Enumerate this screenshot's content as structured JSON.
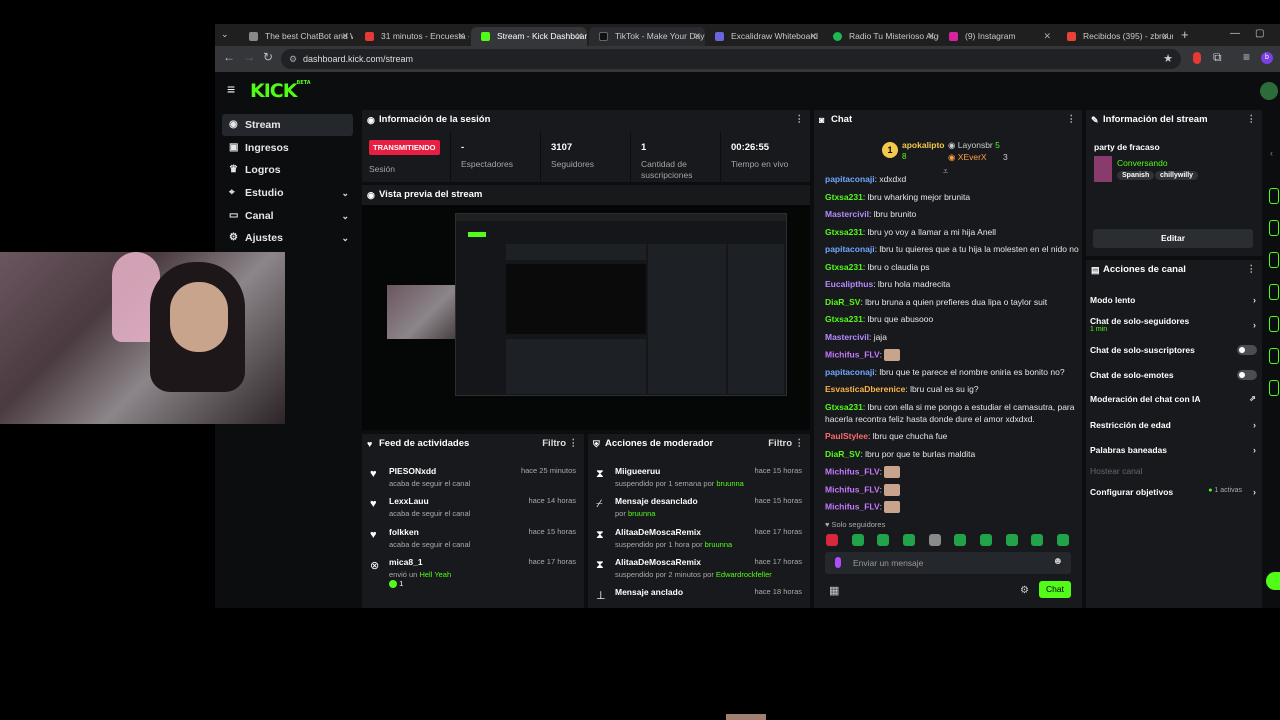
{
  "browser": {
    "tabs": [
      {
        "label": "The best ChatBot and W",
        "color": "#888888"
      },
      {
        "label": "31 minutos - Encuesta - ...",
        "color": "#e53935"
      },
      {
        "label": "Stream - Kick Dashboard",
        "color": "#53fc18"
      },
      {
        "label": "TikTok - Make Your Day",
        "color": "#111111"
      },
      {
        "label": "Excalidraw Whiteboard",
        "color": "#6965db"
      },
      {
        "label": "Radio Tu Misterioso Algu",
        "color": "#1db954"
      },
      {
        "label": "(9) Instagram",
        "color": "#d6249f"
      },
      {
        "label": "Recibidos (395) - zbruun",
        "color": "#ea4335"
      }
    ],
    "url": "dashboard.kick.com/stream",
    "new_tab": "+"
  },
  "brand": {
    "logo": "KICK",
    "beta": "BETA",
    "accent": "#53fc18"
  },
  "sidebar": [
    {
      "label": "Stream",
      "icon": "broadcast-icon"
    },
    {
      "label": "Ingresos",
      "icon": "wallet-icon"
    },
    {
      "label": "Logros",
      "icon": "trophy-icon"
    },
    {
      "label": "Estudio",
      "icon": "studio-icon"
    },
    {
      "label": "Canal",
      "icon": "channel-icon"
    },
    {
      "label": "Ajustes",
      "icon": "gear-icon"
    }
  ],
  "session": {
    "title": "Información de la sesión",
    "status_badge": "TRANSMITIENDO",
    "status_label": "Sesión",
    "stats": [
      {
        "value": "-",
        "label": "Espectadores"
      },
      {
        "value": "3107",
        "label": "Seguidores"
      },
      {
        "value": "1",
        "label": "Cantidad de suscripciones"
      },
      {
        "value": "00:26:55",
        "label": "Tiempo en vivo"
      }
    ]
  },
  "preview": {
    "title": "Vista previa del stream"
  },
  "feed": {
    "title": "Feed de actividades",
    "filter": "Filtro",
    "items": [
      {
        "name": "PIESONxdd",
        "desc": "acaba de seguir el canal",
        "time": "hace 25 minutos"
      },
      {
        "name": "LexxLauu",
        "desc": "acaba de seguir el canal",
        "time": "hace 14 horas"
      },
      {
        "name": "folkken",
        "desc": "acaba de seguir el canal",
        "time": "hace 15 horas"
      },
      {
        "name": "mica8_1",
        "desc": "envió un ",
        "highlight": "Hell Yeah",
        "count": "1",
        "time": "hace 17 horas"
      }
    ]
  },
  "mod": {
    "title": "Acciones de moderador",
    "filter": "Filtro",
    "items": [
      {
        "name": "Miigueeruu",
        "desc": "suspendido por 1 semana por ",
        "by": "bruunna",
        "time": "hace 15 horas"
      },
      {
        "name": "Mensaje desanclado",
        "desc": "por ",
        "by": "bruunna",
        "time": "hace 15 horas"
      },
      {
        "name": "AlitaaDeMoscaRemix",
        "desc": "suspendido por 1 hora por ",
        "by": "bruunna",
        "time": "hace 17 horas"
      },
      {
        "name": "AlitaaDeMoscaRemix",
        "desc": "suspendido por 2 minutos por ",
        "by": "Edwardrockfeller",
        "time": "hace 17 horas"
      },
      {
        "name": "Mensaje anclado",
        "desc": "",
        "by": "",
        "time": "hace 18 horas"
      }
    ]
  },
  "chat": {
    "title": "Chat",
    "top_gifters": [
      {
        "rank": "1",
        "name": "apokalipto",
        "count": "8"
      },
      {
        "name": "Layonsbr",
        "count": "5"
      },
      {
        "name": "XEverX",
        "count": "3"
      }
    ],
    "messages": [
      {
        "user": "papitaconaji",
        "color": "#6ea8ff",
        "text": "xdxdxd"
      },
      {
        "user": "Gtxsa231",
        "color": "#53fc18",
        "text": "lbru wharking mejor brunita"
      },
      {
        "user": "Mastercivil",
        "color": "#b48cff",
        "text": "lbru brunito"
      },
      {
        "user": "Gtxsa231",
        "color": "#53fc18",
        "text": "lbru yo voy a llamar a mi hija Anell"
      },
      {
        "user": "papitaconaji",
        "color": "#6ea8ff",
        "text": "lbru tu quieres que a tu hija la molesten en el nido no"
      },
      {
        "user": "Gtxsa231",
        "color": "#53fc18",
        "text": "lbru o claudia ps"
      },
      {
        "user": "Eucalipthus",
        "color": "#b48cff",
        "text": "lbru hola madrecita"
      },
      {
        "user": "DiaR_SV",
        "color": "#53fc18",
        "text": "lbru bruna a quien prefieres dua lipa o taylor suit"
      },
      {
        "user": "Gtxsa231",
        "color": "#53fc18",
        "text": "lbru que abusooo"
      },
      {
        "user": "Mastercivil",
        "color": "#b48cff",
        "text": "jaja"
      },
      {
        "user": "Michifus_FLV",
        "color": "#c678ff",
        "text": ""
      },
      {
        "user": "papitaconaji",
        "color": "#6ea8ff",
        "text": "lbru que te parece el nombre oniria es bonito no?"
      },
      {
        "user": "EsvasticaDberenice",
        "color": "#ffb347",
        "text": "lbru cual es su ig?"
      },
      {
        "user": "Gtxsa231",
        "color": "#53fc18",
        "text": "lbru con ella si me pongo a estudiar el camasutra, para"
      },
      {
        "user": "",
        "color": "#e6e6e6",
        "text": "hacerla recontra feliz hasta donde dure el amor xdxdxd."
      },
      {
        "user": "PaulStylee",
        "color": "#ff6b6b",
        "text": "lbru que chucha fue"
      },
      {
        "user": "DiaR_SV",
        "color": "#53fc18",
        "text": "lbru por que te burlas maldita"
      },
      {
        "user": "Michifus_FLV",
        "color": "#c678ff",
        "text": ""
      },
      {
        "user": "Michifus_FLV",
        "color": "#c678ff",
        "text": ""
      },
      {
        "user": "Michifus_FLV",
        "color": "#c678ff",
        "text": ""
      }
    ],
    "followers_only": "Solo seguidores",
    "input_placeholder": "Enviar un mensaje",
    "send": "Chat"
  },
  "stream_info": {
    "title": "Información del stream",
    "stream_title": "party de fracaso",
    "category": "Conversando",
    "tags": [
      "Spanish",
      "chillywilly"
    ],
    "edit": "Editar"
  },
  "channel_actions": {
    "title": "Acciones de canal",
    "items": [
      {
        "label": "Modo lento",
        "sub": "",
        "control": "chevron"
      },
      {
        "label": "Chat de solo-seguidores",
        "sub": "1 min",
        "control": "chevron"
      },
      {
        "label": "Chat de solo-suscriptores",
        "sub": "",
        "control": "toggle"
      },
      {
        "label": "Chat de solo-emotes",
        "sub": "",
        "control": "toggle"
      },
      {
        "label": "Moderación del chat con IA",
        "sub": "",
        "control": "external"
      },
      {
        "label": "Restricción de edad",
        "sub": "",
        "control": "chevron"
      },
      {
        "label": "Palabras baneadas",
        "sub": "",
        "control": "chevron"
      },
      {
        "label": "Hostear canal",
        "sub": "",
        "control": "disabled"
      },
      {
        "label": "Configurar objetivos",
        "sub": "",
        "control": "chevron",
        "badge": "1 activas"
      }
    ]
  }
}
